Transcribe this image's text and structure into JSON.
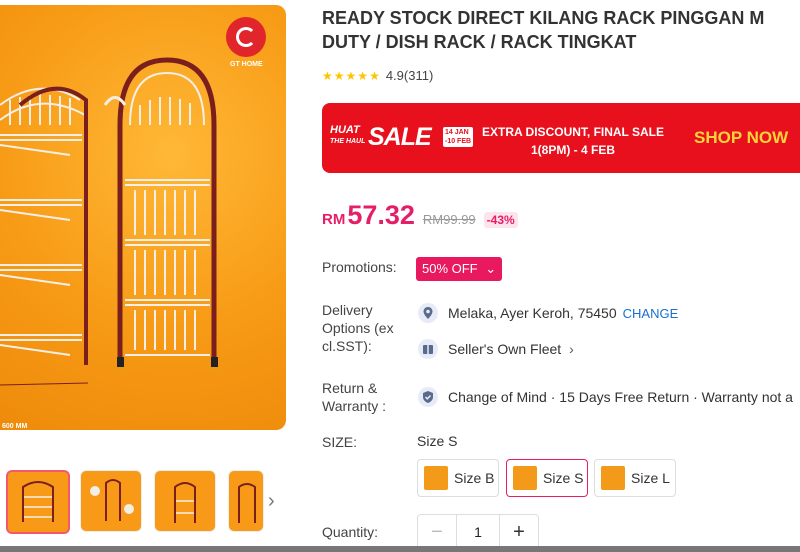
{
  "gallery": {
    "brand_text": "GT HOME",
    "dimension_text": "600 MM",
    "next_icon": "chevron-right-icon"
  },
  "product": {
    "title": "READY STOCK DIRECT KILANG RACK PINGGAN M\nDUTY / DISH RACK / RACK TINGKAT",
    "rating": "4.9",
    "rating_count": "(311)",
    "stars": 5
  },
  "banner": {
    "huat_line1": "HUAT",
    "huat_line2": "THE HAUL",
    "sale": "SALE",
    "dates_line1": "14 JAN",
    "dates_line2": "-10 FEB",
    "msg_line1": "EXTRA DISCOUNT, FINAL SALE",
    "msg_line2": "1(8PM) - 4 FEB",
    "cta": "SHOP NOW"
  },
  "price": {
    "currency": "RM",
    "current": "57.32",
    "original": "RM99.99",
    "discount": "-43%"
  },
  "promotions": {
    "label": "Promotions:",
    "badge": "50% OFF"
  },
  "delivery": {
    "label_line1": "Delivery",
    "label_line2": "Options (ex",
    "label_line3": "cl.SST):",
    "location": "Melaka, Ayer Keroh, 75450",
    "change": "CHANGE",
    "fleet": "Seller's Own Fleet"
  },
  "return": {
    "label_line1": "Return &",
    "label_line2": "Warranty :",
    "text": "Change of Mind · 15 Days Free Return · Warranty not a"
  },
  "size": {
    "label": "SIZE:",
    "selected": "Size S",
    "options": [
      "Size B",
      "Size S",
      "Size L"
    ]
  },
  "quantity": {
    "label": "Quantity:",
    "value": "1",
    "minus": "−",
    "plus": "+"
  },
  "colors": {
    "accent": "#e61e68",
    "banner_red": "#e8101d",
    "hero_orange": "#f79a15"
  }
}
